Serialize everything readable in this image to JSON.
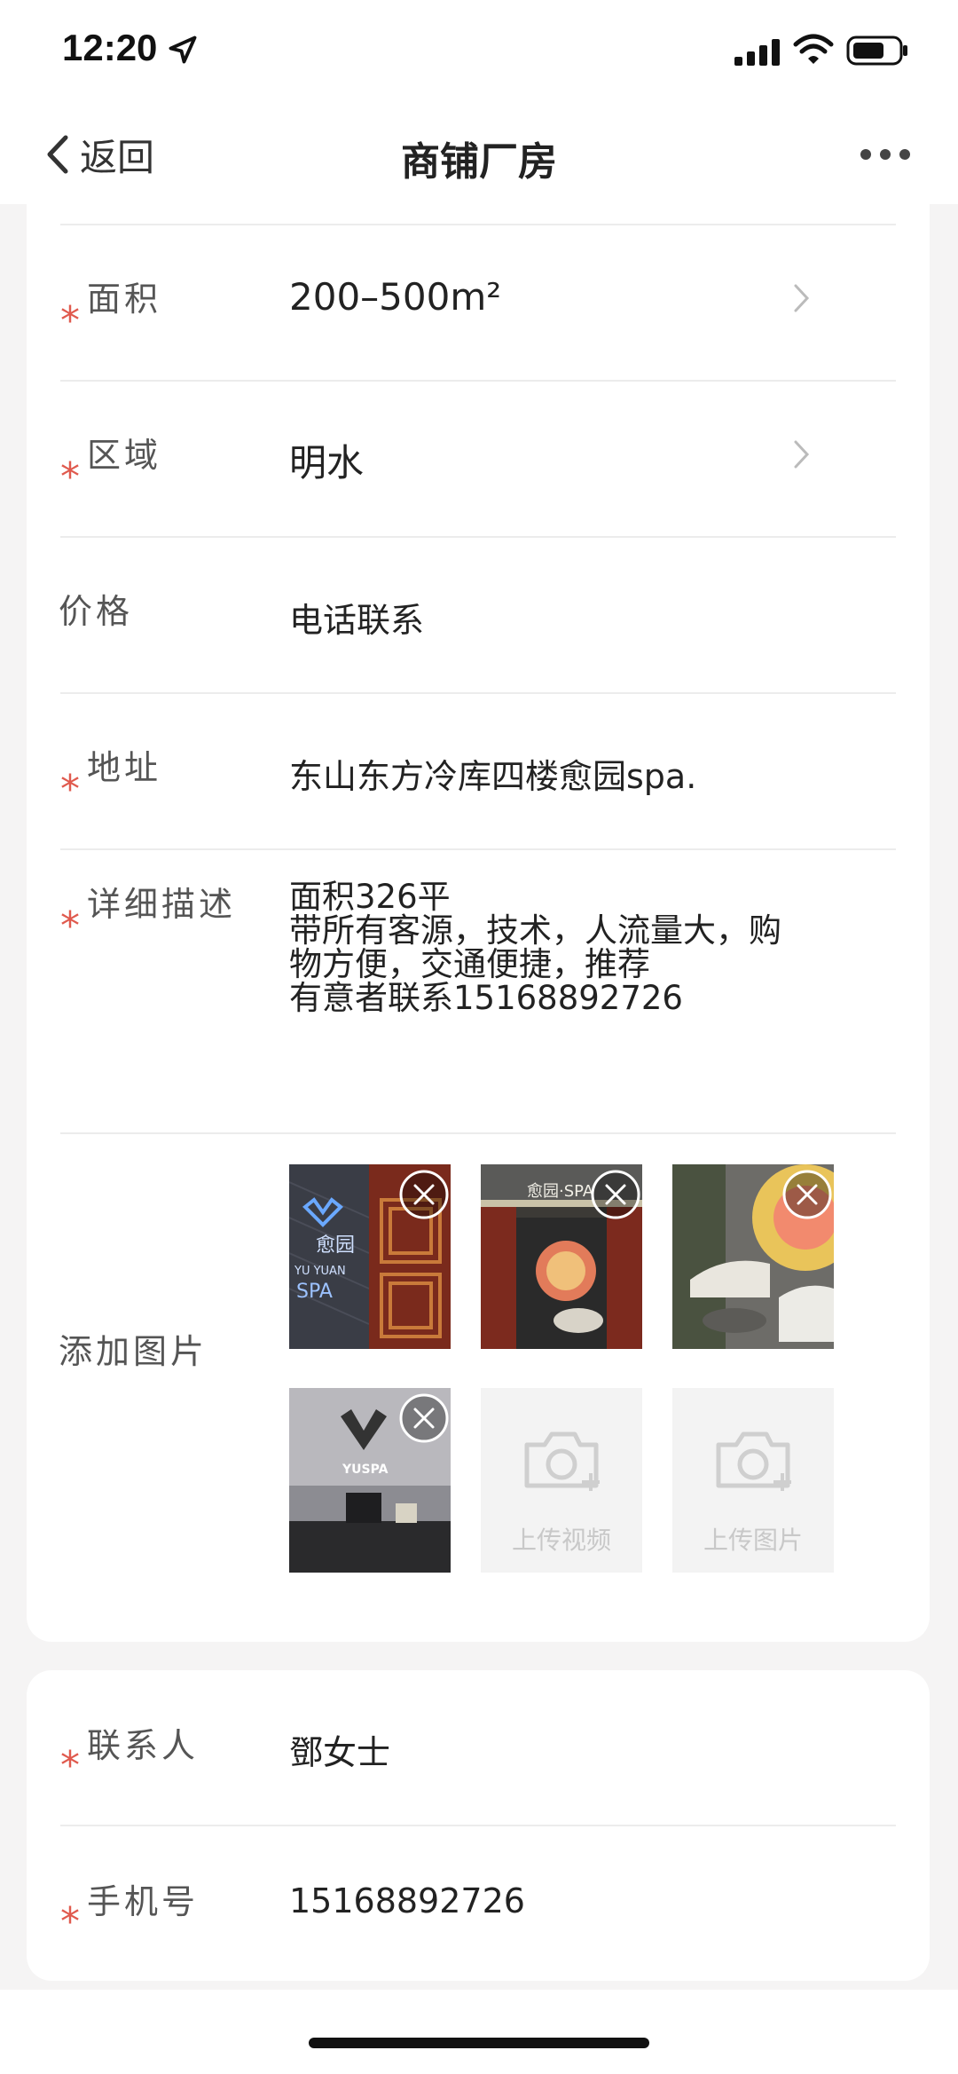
{
  "status_bar": {
    "time": "12:20"
  },
  "nav": {
    "back_label": "返回",
    "title": "商铺厂房"
  },
  "form": {
    "area": {
      "label": "面积",
      "value": "200–500m²"
    },
    "region": {
      "label": "区域",
      "value": "明水"
    },
    "price": {
      "label": "价格",
      "value": "电话联系"
    },
    "address": {
      "label": "地址",
      "value": "东山东方冷库四楼愈园spa."
    },
    "description": {
      "label": "详细描述",
      "lines": [
        "面积326平",
        "带所有客源，技术，人流量大，购",
        "物方便，交通便捷，推荐",
        "有意者联系15168892726"
      ]
    },
    "photos": {
      "label": "添加图片",
      "thumb_texts": [
        "愈园",
        "YU YUAN",
        "SPA",
        "愈园·SPA",
        "YUSPA"
      ],
      "upload_video_label": "上传视频",
      "upload_image_label": "上传图片"
    }
  },
  "contact": {
    "name": {
      "label": "联系人",
      "value": "鄧女士"
    },
    "phone": {
      "label": "手机号",
      "value": "15168892726"
    }
  },
  "required_mark": "*",
  "colors": {
    "required": "#e05a4e",
    "background": "#f5f4f4",
    "card": "#ffffff"
  },
  "icons": [
    "location-arrow-icon",
    "signal-icon",
    "wifi-icon",
    "battery-icon",
    "back-chevron-icon",
    "more-icon",
    "chevron-right-icon",
    "close-icon",
    "camera-icon"
  ]
}
